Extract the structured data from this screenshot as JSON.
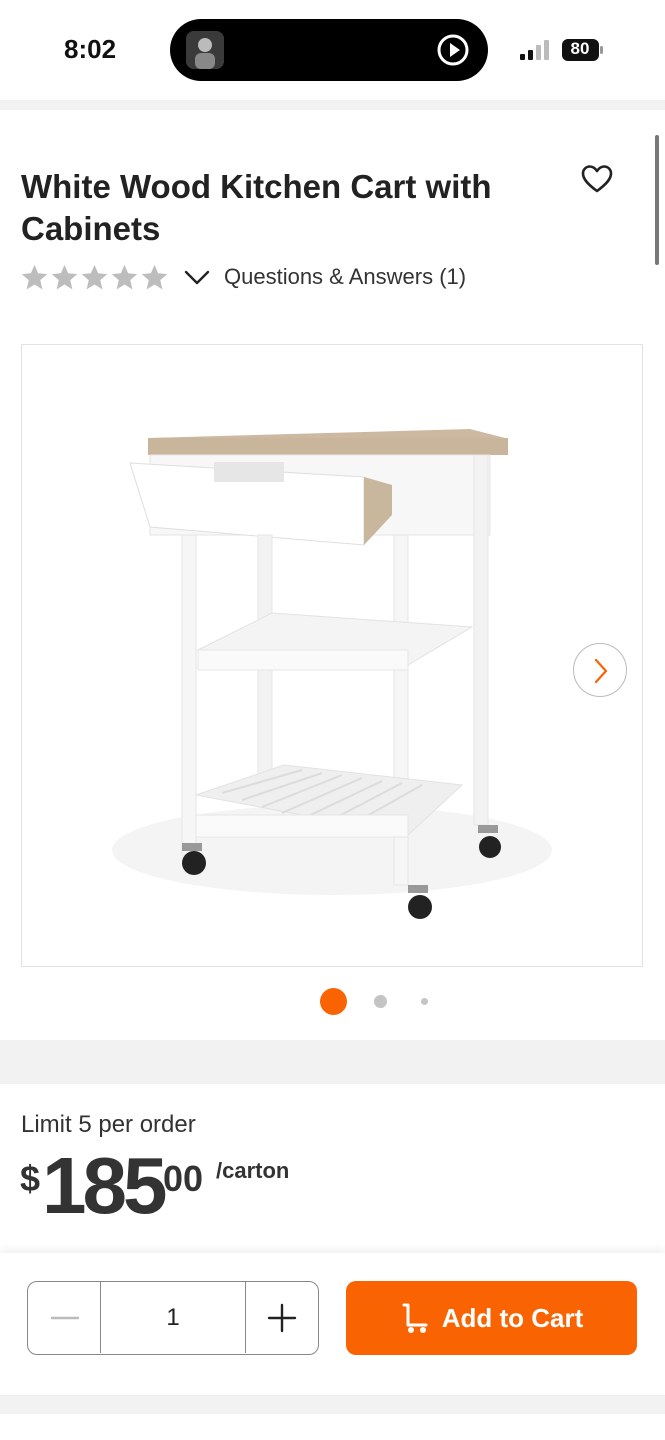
{
  "status_bar": {
    "time": "8:02",
    "battery": "80"
  },
  "product": {
    "title": "White Wood Kitchen Cart with Cabinets",
    "rating_stars": 0,
    "qa_link": "Questions & Answers (1)",
    "image_count": 3,
    "active_image": 0
  },
  "pricing": {
    "limit": "Limit 5 per order",
    "currency": "$",
    "whole": "185",
    "cents": "00",
    "unit": "/carton"
  },
  "cart": {
    "quantity": "1",
    "add_label": "Add to Cart"
  },
  "icons": {
    "favorite": "heart-icon",
    "chevron": "chevron-down-icon",
    "next": "chevron-right-icon",
    "minus": "minus-icon",
    "plus": "plus-icon",
    "cart": "cart-icon"
  },
  "colors": {
    "accent": "#f96302",
    "star_empty": "#bdbdbd"
  }
}
